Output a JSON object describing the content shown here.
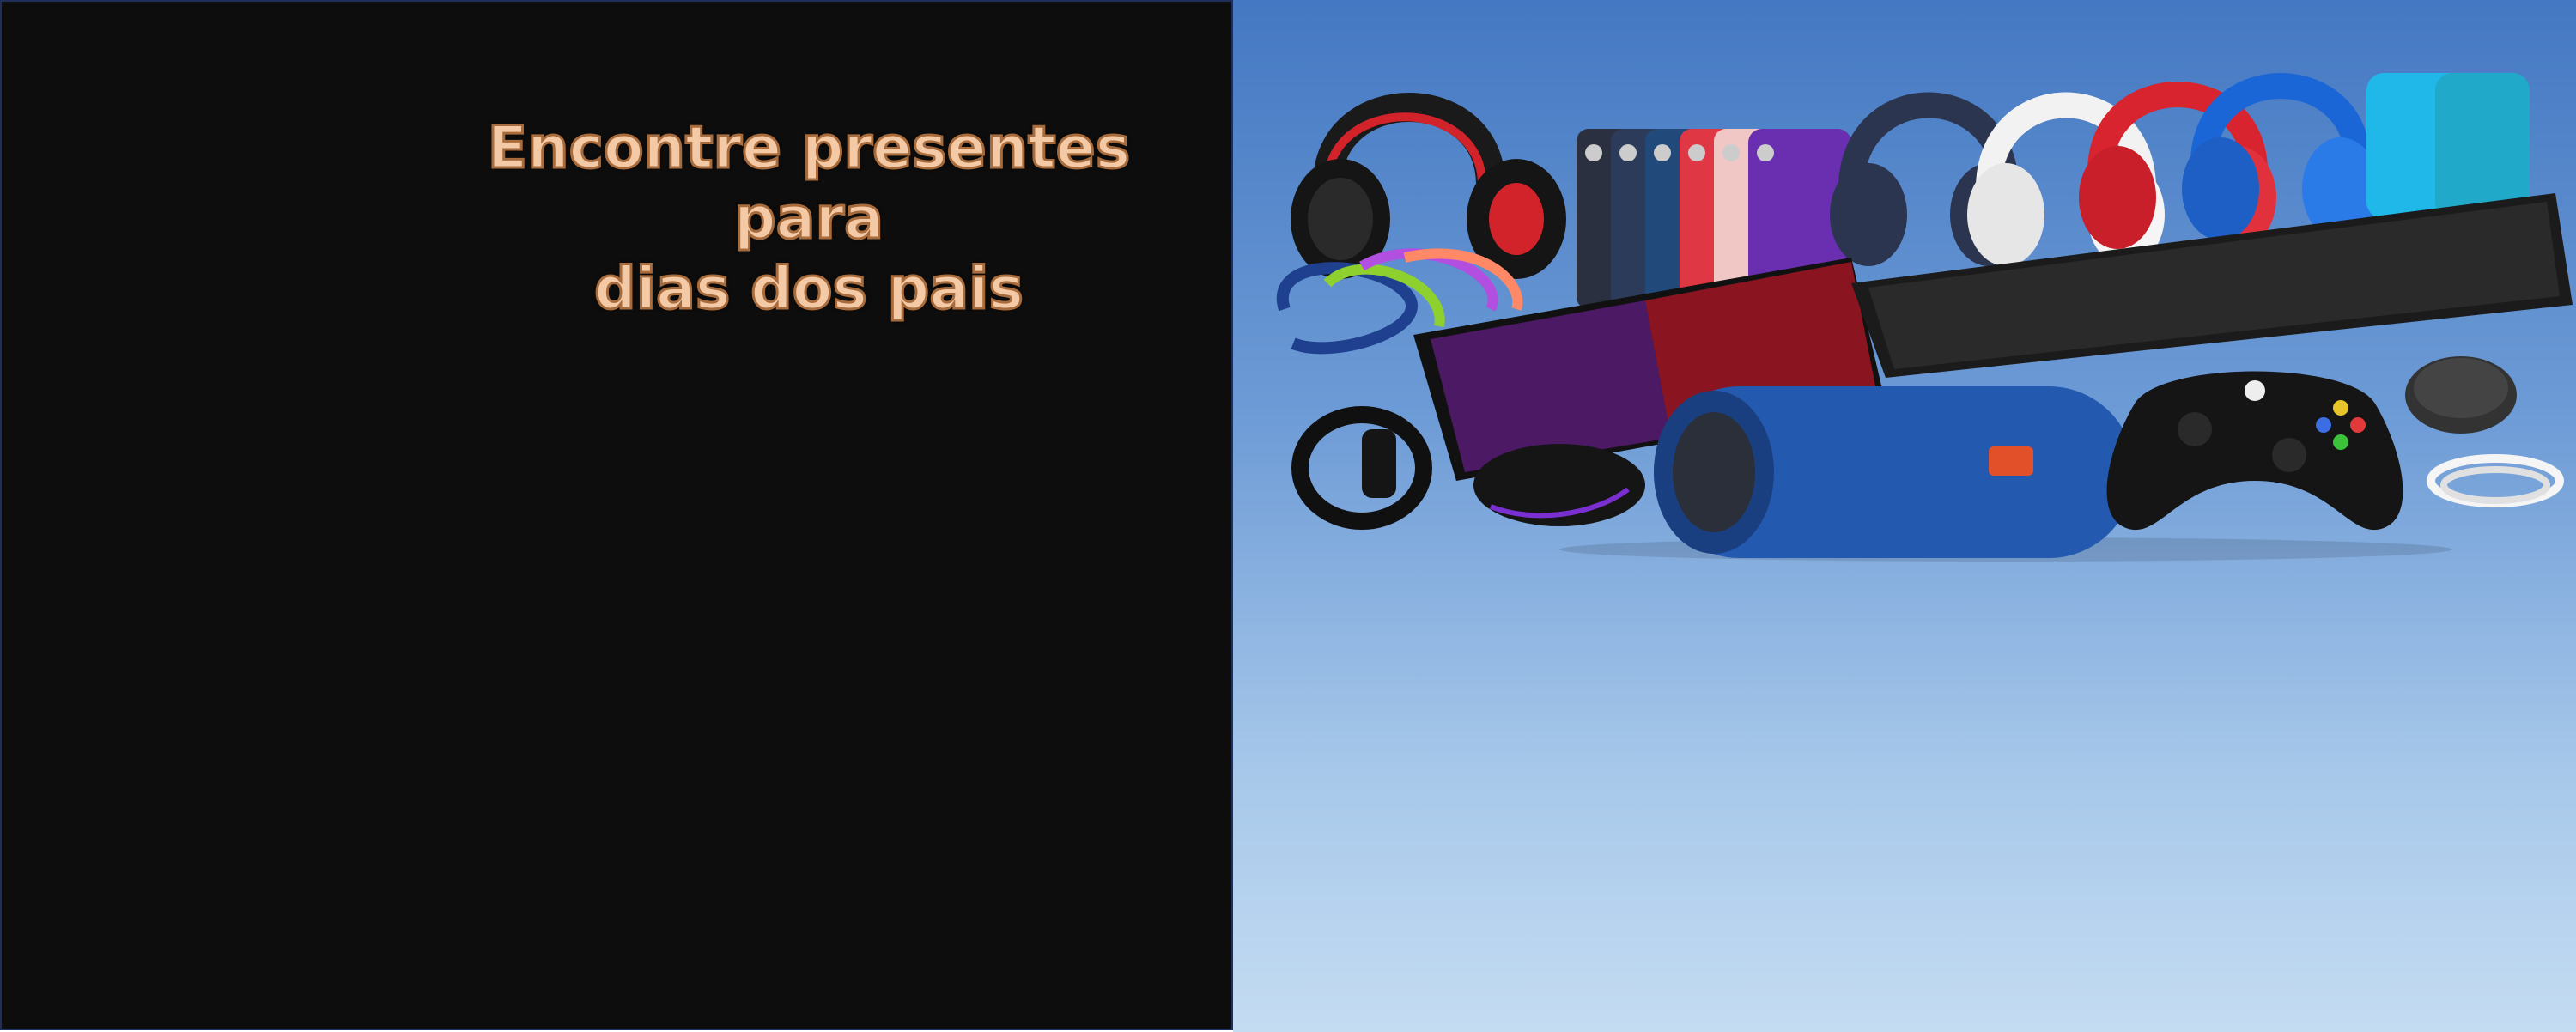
{
  "banner": {
    "headline_line1": "Encontre presentes para",
    "headline_line2": "dias dos pais"
  },
  "colors": {
    "left_background": "#0e0d0d",
    "headline_fill": "#f3c9a6",
    "headline_outline": "#a86b3c",
    "sky_top": "#4478c2",
    "sky_bottom": "#c4dcf2"
  },
  "products_icons": [
    "gaming-headset-icon",
    "phone-cases-icon",
    "wireless-headphones-icon",
    "usb-cables-icon",
    "rgb-keyboard-icon",
    "black-keyboard-icon",
    "fitness-band-icon",
    "gaming-mouse-icon",
    "bluetooth-speaker-icon",
    "game-controller-icon",
    "wireless-mouse-icon",
    "charging-cable-icon"
  ]
}
